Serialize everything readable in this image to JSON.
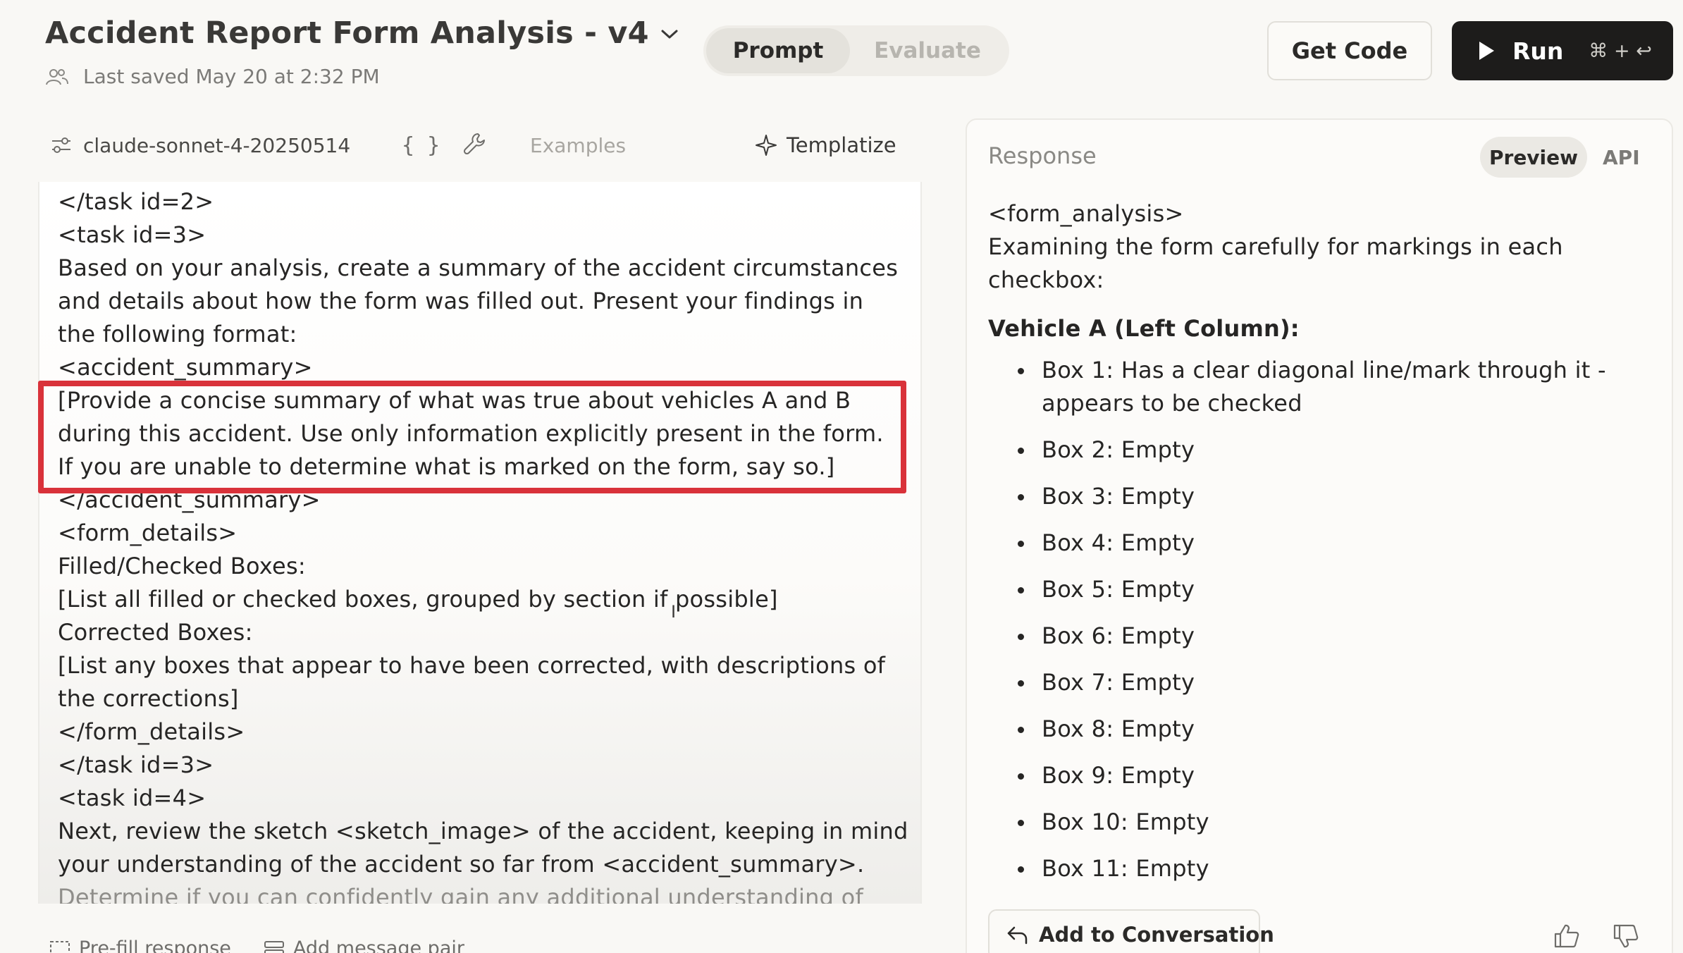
{
  "header": {
    "title": "Accident Report Form Analysis - v4",
    "saved": "Last saved May 20 at 2:32 PM"
  },
  "tabs": {
    "prompt": "Prompt",
    "evaluate": "Evaluate"
  },
  "actions": {
    "get_code": "Get Code",
    "run": "Run",
    "run_shortcut": "⌘ + ↩"
  },
  "toolbar": {
    "model": "claude-sonnet-4-20250514",
    "braces": "{ }",
    "examples": "Examples",
    "templatize": "Templatize"
  },
  "editor": {
    "lines": [
      "</task id=2>",
      "<task id=3>",
      "Based on your analysis, create a summary of the accident circumstances",
      "and details about how the form was filled out. Present your findings in",
      "the following format:",
      "<accident_summary>",
      "[Provide a concise summary of what was true about vehicles A and B",
      "during this accident. Use only information explicitly present in the form.",
      "If you are unable to determine what is marked on the form, say so.]",
      "</accident_summary>",
      "<form_details>",
      "Filled/Checked Boxes:",
      "[List all filled or checked boxes, grouped by section if possible]",
      "Corrected Boxes:",
      "[List any boxes that appear to have been corrected, with descriptions of",
      "the corrections]",
      "</form_details>",
      "</task id=3>",
      "<task id=4>",
      "Next, review the sketch <sketch_image> of the accident, keeping in mind",
      "your understanding of the accident so far from <accident_summary>.",
      "Determine if you can confidently gain any additional understanding of"
    ]
  },
  "bottom": {
    "prefill": "Pre-fill response",
    "add_pair": "Add message pair"
  },
  "response": {
    "title": "Response",
    "preview": "Preview",
    "api": "API",
    "intro_lines": [
      "<form_analysis>",
      "Examining the form carefully for markings in each",
      "checkbox:"
    ],
    "heading": "Vehicle A (Left Column):",
    "bullets": [
      [
        "Box 1: Has a clear diagonal line/mark through it -",
        "appears to be checked"
      ],
      [
        "Box 2: Empty"
      ],
      [
        "Box 3: Empty"
      ],
      [
        "Box 4: Empty"
      ],
      [
        "Box 5: Empty"
      ],
      [
        "Box 6: Empty"
      ],
      [
        "Box 7: Empty"
      ],
      [
        "Box 8: Empty"
      ],
      [
        "Box 9: Empty"
      ],
      [
        "Box 10: Empty"
      ],
      [
        "Box 11: Empty"
      ]
    ],
    "add_to_conversation": "Add to Conversation"
  },
  "colors": {
    "highlight": "#d9323a",
    "run_bg": "#1d1c1b"
  },
  "icons": [
    "chevron-down-icon",
    "people-icon",
    "sliders-icon",
    "wrench-icon",
    "sparkle-icon",
    "play-icon",
    "reply-icon",
    "thumbs-up-icon",
    "thumbs-down-icon",
    "text-cursor-icon",
    "prefill-icon",
    "message-pair-icon"
  ]
}
